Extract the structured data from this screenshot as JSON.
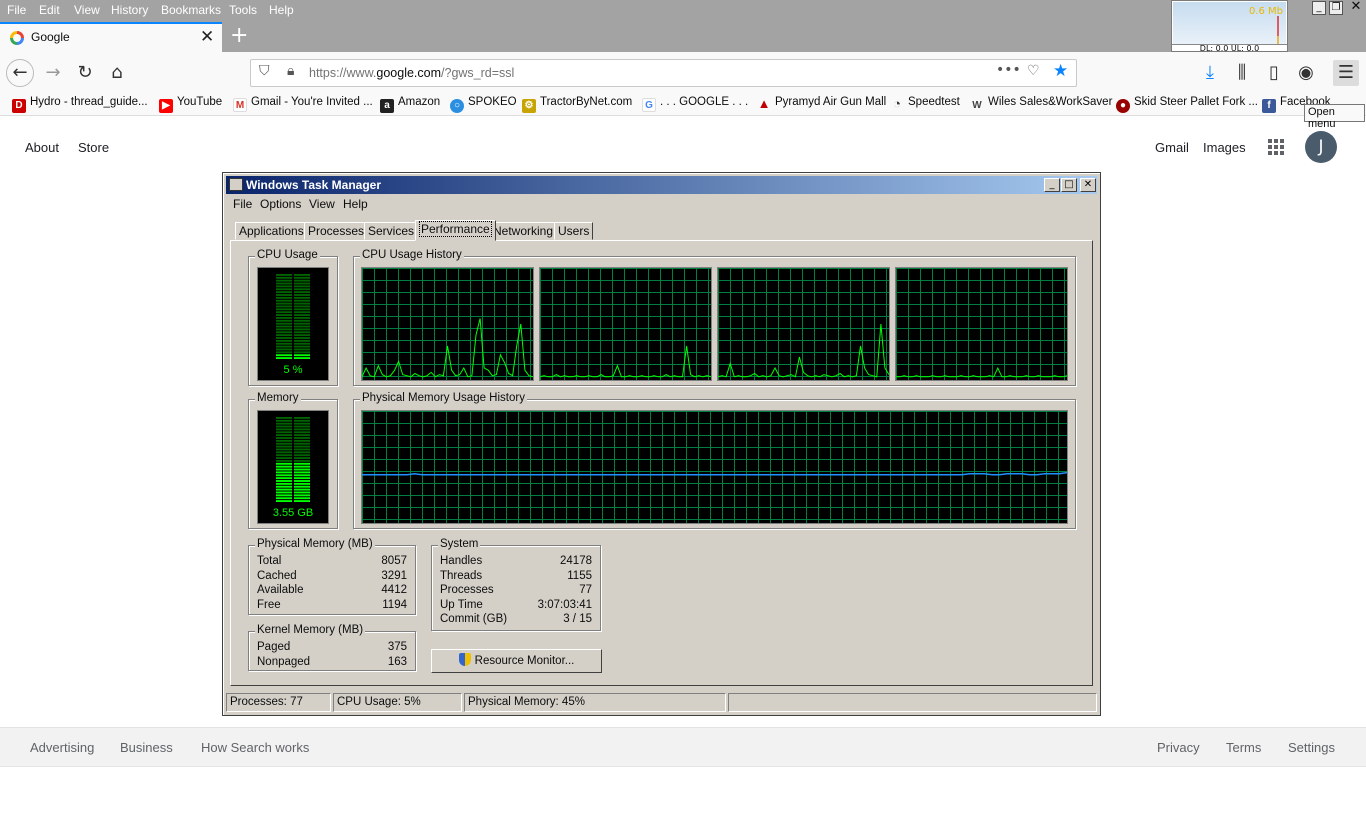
{
  "browser": {
    "menu": [
      "File",
      "Edit",
      "View",
      "History",
      "Bookmarks",
      "Tools",
      "Help"
    ],
    "tab_title": "Google",
    "url_prefix": "https://www.",
    "url_domain": "google.com",
    "url_suffix": "/?gws_rd=ssl",
    "bookmarks": [
      {
        "label": "Hydro - thread_guide...",
        "icon": "d-logo-icon",
        "color": "#cc0000"
      },
      {
        "label": "YouTube",
        "icon": "youtube-icon",
        "color": "#ff0000"
      },
      {
        "label": "Gmail - You're Invited ...",
        "icon": "gmail-icon",
        "color": "#d93025"
      },
      {
        "label": "Amazon",
        "icon": "amazon-icon",
        "color": "#222222"
      },
      {
        "label": "SPOKEO",
        "icon": "spokeo-icon",
        "color": "#2a8fe0"
      },
      {
        "label": "TractorByNet.com",
        "icon": "tractor-icon",
        "color": "#c8a400"
      },
      {
        "label": ". . . GOOGLE . . .",
        "icon": "google-icon",
        "color": "#4285f4"
      },
      {
        "label": "Pyramyd Air Gun Mall",
        "icon": "pyramid-icon",
        "color": "#c00000"
      },
      {
        "label": "Speedtest",
        "icon": "speedtest-icon",
        "color": "#333333"
      },
      {
        "label": "Wiles Sales&WorkSaver",
        "icon": "w-logo-icon",
        "color": "#444444"
      },
      {
        "label": "Skid Steer Pallet Fork ...",
        "icon": "skid-icon",
        "color": "#990000"
      },
      {
        "label": "Facebook",
        "icon": "facebook-icon",
        "color": "#3b5998"
      }
    ],
    "tooltip": "Open menu",
    "net_meter": {
      "value": "0.6 Mb",
      "dlul": "DL: 0.0 UL: 0.0"
    }
  },
  "google": {
    "about": "About",
    "store": "Store",
    "gmail": "Gmail",
    "images": "Images",
    "avatar_letter": "J",
    "footer_left": [
      "Advertising",
      "Business",
      "How Search works"
    ],
    "footer_right": [
      "Privacy",
      "Terms",
      "Settings"
    ]
  },
  "taskmanager": {
    "title": "Windows Task Manager",
    "menu": [
      "File",
      "Options",
      "View",
      "Help"
    ],
    "tabs": [
      "Applications",
      "Processes",
      "Services",
      "Performance",
      "Networking",
      "Users"
    ],
    "active_tab": "Performance",
    "cpu_usage_label": "CPU Usage",
    "cpu_usage_value": "5 %",
    "cpu_usage_fraction": 0.05,
    "cpu_history_label": "CPU Usage History",
    "memory_label": "Memory",
    "memory_value": "3.55 GB",
    "memory_fraction": 0.45,
    "memory_history_label": "Physical Memory Usage History",
    "physical_memory": {
      "title": "Physical Memory (MB)",
      "rows": [
        {
          "label": "Total",
          "value": "8057"
        },
        {
          "label": "Cached",
          "value": "3291"
        },
        {
          "label": "Available",
          "value": "4412"
        },
        {
          "label": "Free",
          "value": "1194"
        }
      ]
    },
    "kernel_memory": {
      "title": "Kernel Memory (MB)",
      "rows": [
        {
          "label": "Paged",
          "value": "375"
        },
        {
          "label": "Nonpaged",
          "value": "163"
        }
      ]
    },
    "system": {
      "title": "System",
      "rows": [
        {
          "label": "Handles",
          "value": "24178"
        },
        {
          "label": "Threads",
          "value": "1155"
        },
        {
          "label": "Processes",
          "value": "77"
        },
        {
          "label": "Up Time",
          "value": "3:07:03:41"
        },
        {
          "label": "Commit (GB)",
          "value": "3 / 15"
        }
      ]
    },
    "resource_monitor": "Resource Monitor...",
    "status": {
      "processes": "Processes: 77",
      "cpu": "CPU Usage: 5%",
      "memory": "Physical Memory: 45%"
    },
    "cpu_history": [
      [
        2,
        10,
        3,
        2,
        12,
        4,
        2,
        3,
        8,
        16,
        4,
        3,
        2,
        5,
        3,
        2,
        3,
        6,
        2,
        4,
        3,
        30,
        8,
        3,
        4,
        10,
        2,
        3,
        40,
        55,
        10,
        8,
        3,
        4,
        22,
        15,
        5,
        3,
        30,
        50,
        8,
        3,
        2
      ],
      [
        2,
        3,
        2,
        2,
        4,
        2,
        3,
        2,
        2,
        3,
        2,
        2,
        3,
        2,
        2,
        4,
        2,
        2,
        3,
        12,
        2,
        2,
        3,
        2,
        2,
        3,
        2,
        2,
        3,
        2,
        2,
        4,
        2,
        3,
        2,
        2,
        30,
        4,
        2,
        3,
        2,
        3,
        2
      ],
      [
        2,
        3,
        2,
        14,
        2,
        3,
        2,
        2,
        3,
        5,
        2,
        3,
        2,
        3,
        10,
        3,
        2,
        3,
        4,
        2,
        20,
        6,
        3,
        2,
        3,
        2,
        4,
        3,
        2,
        3,
        5,
        2,
        3,
        2,
        3,
        30,
        10,
        4,
        3,
        2,
        50,
        10,
        4
      ],
      [
        2,
        2,
        3,
        2,
        2,
        3,
        2,
        2,
        2,
        3,
        2,
        2,
        3,
        2,
        2,
        2,
        3,
        2,
        2,
        3,
        2,
        2,
        2,
        3,
        2,
        10,
        2,
        2,
        3,
        2,
        2,
        2,
        3,
        2,
        2,
        3,
        2,
        2,
        2,
        3,
        2,
        2,
        3
      ]
    ],
    "memory_history": [
      43,
      43,
      43,
      43,
      43,
      43,
      43,
      44,
      43,
      43,
      43,
      43,
      43,
      43,
      43,
      43,
      43,
      43,
      43,
      43,
      43,
      43,
      43,
      43,
      43,
      43,
      43,
      43,
      43,
      43,
      43,
      43,
      43,
      43,
      43,
      43,
      43,
      43,
      43,
      43,
      43,
      43,
      43,
      43,
      43,
      43,
      43,
      43,
      43,
      43,
      43,
      43,
      43,
      43,
      43,
      43,
      43,
      43,
      43,
      43,
      43,
      43,
      43,
      43,
      43,
      43,
      43,
      43,
      43,
      43,
      43,
      43,
      43,
      43,
      43,
      43,
      43,
      43,
      43,
      43,
      43,
      44,
      44,
      44,
      43,
      43,
      44,
      44,
      44,
      43,
      43,
      44,
      44,
      44,
      45
    ]
  }
}
